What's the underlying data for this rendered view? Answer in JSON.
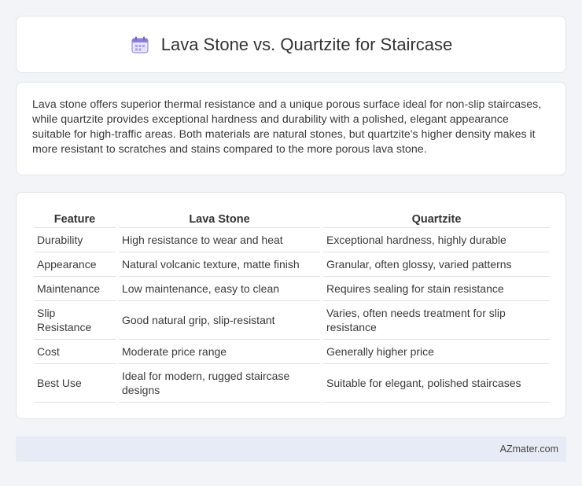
{
  "header": {
    "title": "Lava Stone vs. Quartzite for Staircase",
    "icon": "calendar-icon"
  },
  "intro": {
    "text": "Lava stone offers superior thermal resistance and a unique porous surface ideal for non-slip staircases, while quartzite provides exceptional hardness and durability with a polished, elegant appearance suitable for high-traffic areas. Both materials are natural stones, but quartzite's higher density makes it more resistant to scratches and stains compared to the more porous lava stone."
  },
  "table": {
    "headers": [
      "Feature",
      "Lava Stone",
      "Quartzite"
    ],
    "rows": [
      [
        "Durability",
        "High resistance to wear and heat",
        "Exceptional hardness, highly durable"
      ],
      [
        "Appearance",
        "Natural volcanic texture, matte finish",
        "Granular, often glossy, varied patterns"
      ],
      [
        "Maintenance",
        "Low maintenance, easy to clean",
        "Requires sealing for stain resistance"
      ],
      [
        "Slip Resistance",
        "Good natural grip, slip-resistant",
        "Varies, often needs treatment for slip resistance"
      ],
      [
        "Cost",
        "Moderate price range",
        "Generally higher price"
      ],
      [
        "Best Use",
        "Ideal for modern, rugged staircase designs",
        "Suitable for elegant, polished staircases"
      ]
    ]
  },
  "footer": {
    "text": "AZmater.com"
  },
  "colors": {
    "background": "#f3f4f8",
    "card": "#ffffff",
    "footer_bar": "#e6ebf5",
    "icon_accent": "#8b7fd6"
  }
}
